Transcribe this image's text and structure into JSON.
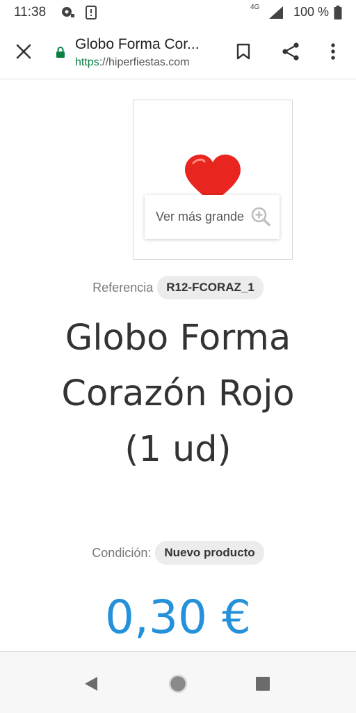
{
  "status_bar": {
    "time": "11:38",
    "network": "4G",
    "battery": "100 %",
    "icons": [
      "record-icon",
      "alert-icon",
      "signal-icon",
      "battery-icon"
    ]
  },
  "toolbar": {
    "page_title": "Globo Forma Cor...",
    "url_scheme": "https",
    "url_rest": "://hiperfiestas.com",
    "icons": [
      "close-icon",
      "lock-icon",
      "bookmark-icon",
      "share-icon",
      "more-vert-icon"
    ]
  },
  "product": {
    "zoom_label": "Ver más grande",
    "reference_label": "Referencia",
    "reference_value": "R12-FCORAZ_1",
    "name": "Globo Forma Corazón Rojo (1 ud)",
    "condition_label": "Condición:",
    "condition_value": "Nuevo producto",
    "price": "0,30 €"
  },
  "colors": {
    "price": "#2591db",
    "heart": "#e8261f",
    "lock": "#0b8043"
  },
  "nav_bar": {
    "icons": [
      "back-icon",
      "home-icon",
      "recents-icon"
    ]
  }
}
